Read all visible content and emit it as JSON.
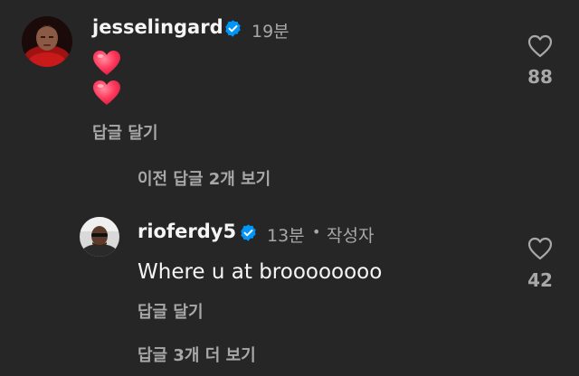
{
  "comment1": {
    "username": "jesselingard",
    "time": "19분",
    "body_emoji": [
      "❤",
      "❤"
    ],
    "reply_label": "답글 달기",
    "like_count": "88",
    "view_prev_replies": "이전 답글 2개 보기"
  },
  "comment2": {
    "username": "rioferdy5",
    "time": "13분",
    "dot": "•",
    "author_badge": "작성자",
    "text": "Where u at broooooooo",
    "reply_label": "답글 달기",
    "like_count": "42",
    "view_more_replies": "답글 3개 더 보기"
  },
  "colors": {
    "background": "#262626",
    "verified": "#0095f6",
    "muted": "#a8a8a8",
    "heart_emoji": "#ff3b5c"
  }
}
